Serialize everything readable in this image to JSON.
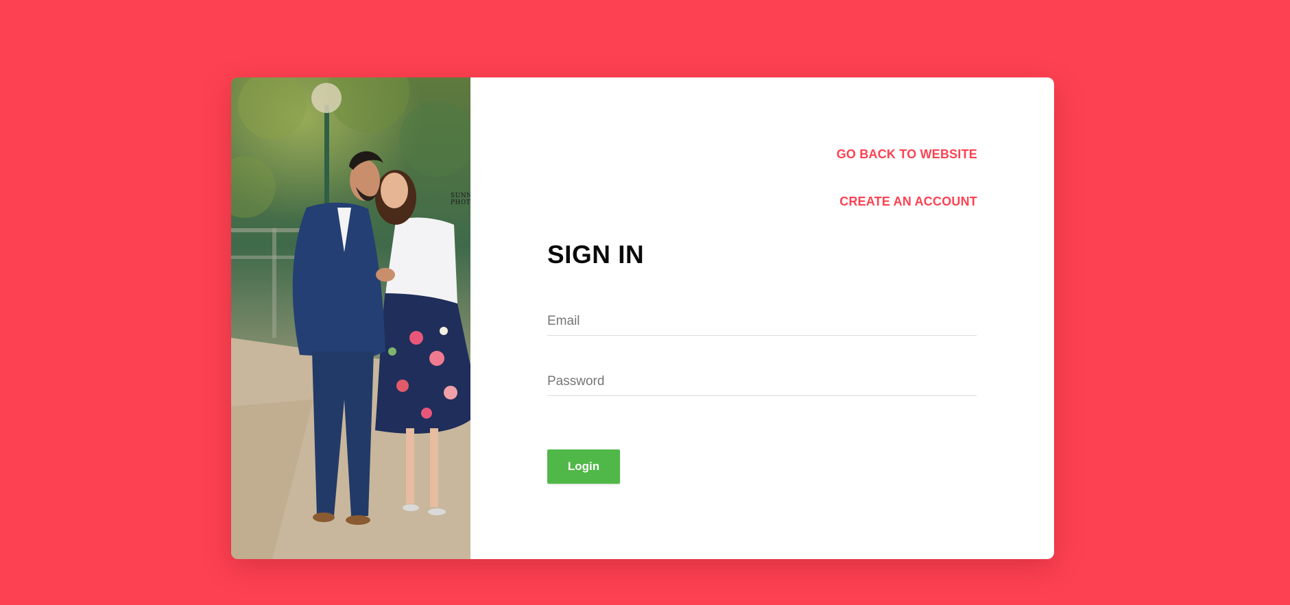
{
  "colors": {
    "background": "#fd4152",
    "card": "#ffffff",
    "accent": "#fd4152",
    "button": "#50b848",
    "button_text": "#ffffff",
    "title": "#0a0a0a"
  },
  "photo": {
    "icon": "couple-photo",
    "credit_line1": "SUNNY",
    "credit_line2": "PHOTO"
  },
  "nav": {
    "back_label": "GO BACK TO WEBSITE",
    "create_label": "CREATE AN ACCOUNT"
  },
  "form": {
    "title": "SIGN IN",
    "email": {
      "value": "",
      "placeholder": "Email"
    },
    "password": {
      "value": "",
      "placeholder": "Password"
    },
    "login_label": "Login"
  }
}
